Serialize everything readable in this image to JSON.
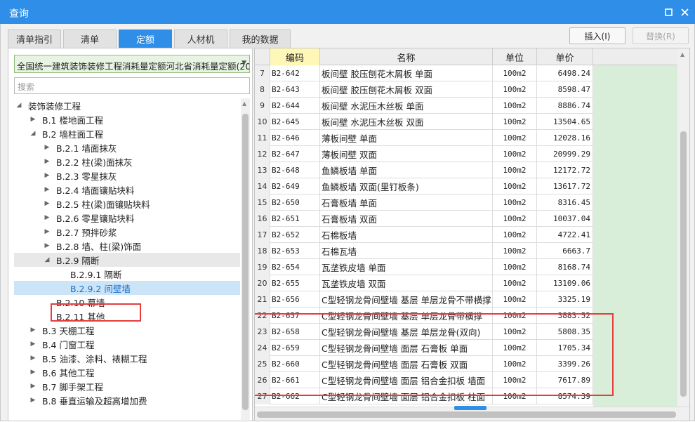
{
  "window": {
    "title": "查询"
  },
  "tabs": [
    {
      "label": "清单指引"
    },
    {
      "label": "清单"
    },
    {
      "label": "定额",
      "active": true
    },
    {
      "label": "人材机"
    },
    {
      "label": "我的数据"
    }
  ],
  "actions": {
    "insert": "插入(I)",
    "replace": "替换(R)"
  },
  "quota_library": {
    "selected": "全国统一建筑装饰装修工程消耗量定额河北省消耗量定额(20"
  },
  "search": {
    "placeholder": "搜索"
  },
  "tree": [
    {
      "label": "装饰装修工程",
      "level": 0,
      "expanded": true
    },
    {
      "label": "B.1 楼地面工程",
      "level": 1,
      "expanded": false
    },
    {
      "label": "B.2 墙柱面工程",
      "level": 1,
      "expanded": true
    },
    {
      "label": "B.2.1 墙面抹灰",
      "level": 2,
      "expanded": false
    },
    {
      "label": "B.2.2 柱(梁)面抹灰",
      "level": 2,
      "expanded": false
    },
    {
      "label": "B.2.3 零星抹灰",
      "level": 2,
      "expanded": false
    },
    {
      "label": "B.2.4 墙面镶贴块料",
      "level": 2,
      "expanded": false
    },
    {
      "label": "B.2.5 柱(梁)面镶贴块料",
      "level": 2,
      "expanded": false
    },
    {
      "label": "B.2.6 零星镶贴块料",
      "level": 2,
      "expanded": false
    },
    {
      "label": "B.2.7 预拌砂浆",
      "level": 2,
      "expanded": false
    },
    {
      "label": "B.2.8 墙、柱(梁)饰面",
      "level": 2,
      "expanded": false
    },
    {
      "label": "B.2.9 隔断",
      "level": 2,
      "expanded": true,
      "hover": true
    },
    {
      "label": "B.2.9.1 隔断",
      "level": 3
    },
    {
      "label": "B.2.9.2 间壁墙",
      "level": 3,
      "selected": true
    },
    {
      "label": "B.2.10 幕墙",
      "level": 2
    },
    {
      "label": "B.2.11 其他",
      "level": 2
    },
    {
      "label": "B.3 天棚工程",
      "level": 1,
      "expanded": false
    },
    {
      "label": "B.4 门窗工程",
      "level": 1,
      "expanded": false
    },
    {
      "label": "B.5 油漆、涂料、裱糊工程",
      "level": 1,
      "expanded": false
    },
    {
      "label": "B.6 其他工程",
      "level": 1,
      "expanded": false
    },
    {
      "label": "B.7 脚手架工程",
      "level": 1,
      "expanded": false
    },
    {
      "label": "B.8 垂直运输及超高增加费",
      "level": 1,
      "expanded": false
    }
  ],
  "table": {
    "headers": {
      "code": "编码",
      "name": "名称",
      "unit": "单位",
      "price": "单价"
    },
    "rows": [
      {
        "idx": "7",
        "code": "B2-642",
        "name": "板间壁 胶压刨花木屑板 单面",
        "unit": "100m2",
        "price": "6498.24"
      },
      {
        "idx": "8",
        "code": "B2-643",
        "name": "板间壁 胶压刨花木屑板 双面",
        "unit": "100m2",
        "price": "8598.47"
      },
      {
        "idx": "9",
        "code": "B2-644",
        "name": "板间壁 水泥压木丝板 单面",
        "unit": "100m2",
        "price": "8886.74"
      },
      {
        "idx": "10",
        "code": "B2-645",
        "name": "板间壁 水泥压木丝板 双面",
        "unit": "100m2",
        "price": "13504.65"
      },
      {
        "idx": "11",
        "code": "B2-646",
        "name": "薄板间壁 单面",
        "unit": "100m2",
        "price": "12028.16"
      },
      {
        "idx": "12",
        "code": "B2-647",
        "name": "薄板间壁 双面",
        "unit": "100m2",
        "price": "20999.29"
      },
      {
        "idx": "13",
        "code": "B2-648",
        "name": "鱼鳞板墙 单面",
        "unit": "100m2",
        "price": "12172.72"
      },
      {
        "idx": "14",
        "code": "B2-649",
        "name": "鱼鳞板墙 双面(里钉板条)",
        "unit": "100m2",
        "price": "13617.72"
      },
      {
        "idx": "15",
        "code": "B2-650",
        "name": "石膏板墙 单面",
        "unit": "100m2",
        "price": "8316.45"
      },
      {
        "idx": "16",
        "code": "B2-651",
        "name": "石膏板墙 双面",
        "unit": "100m2",
        "price": "10037.04"
      },
      {
        "idx": "17",
        "code": "B2-652",
        "name": "石棉板墙",
        "unit": "100m2",
        "price": "4722.41"
      },
      {
        "idx": "18",
        "code": "B2-653",
        "name": "石棉瓦墙",
        "unit": "100m2",
        "price": "6663.7"
      },
      {
        "idx": "19",
        "code": "B2-654",
        "name": "瓦垄铁皮墙 单面",
        "unit": "100m2",
        "price": "8168.74"
      },
      {
        "idx": "20",
        "code": "B2-655",
        "name": "瓦垄铁皮墙 双面",
        "unit": "100m2",
        "price": "13109.06"
      },
      {
        "idx": "21",
        "code": "B2-656",
        "name": "C型轻钢龙骨间壁墙 基层 单层龙骨不带横撑",
        "unit": "100m2",
        "price": "3325.19"
      },
      {
        "idx": "22",
        "code": "B2-657",
        "name": "C型轻钢龙骨间壁墙 基层 单层龙骨带横撑",
        "unit": "100m2",
        "price": "3883.52"
      },
      {
        "idx": "23",
        "code": "B2-658",
        "name": "C型轻钢龙骨间壁墙 基层 单层龙骨(双向)",
        "unit": "100m2",
        "price": "5808.35"
      },
      {
        "idx": "24",
        "code": "B2-659",
        "name": "C型轻钢龙骨间壁墙 面层 石膏板 单面",
        "unit": "100m2",
        "price": "1705.34"
      },
      {
        "idx": "25",
        "code": "B2-660",
        "name": "C型轻钢龙骨间壁墙 面层 石膏板 双面",
        "unit": "100m2",
        "price": "3399.26"
      },
      {
        "idx": "26",
        "code": "B2-661",
        "name": "C型轻钢龙骨间壁墙 面层 铝合金扣板 墙面",
        "unit": "100m2",
        "price": "7617.89"
      },
      {
        "idx": "27",
        "code": "B2-662",
        "name": "C型轻钢龙骨间壁墙 面层 铝合金扣板 柱面",
        "unit": "100m2",
        "price": "8574.39"
      }
    ]
  },
  "colors": {
    "accent": "#2e8ee8",
    "highlight": "#e53d3d",
    "code_header": "#fff7b8",
    "side_fill": "#d9eed8"
  }
}
